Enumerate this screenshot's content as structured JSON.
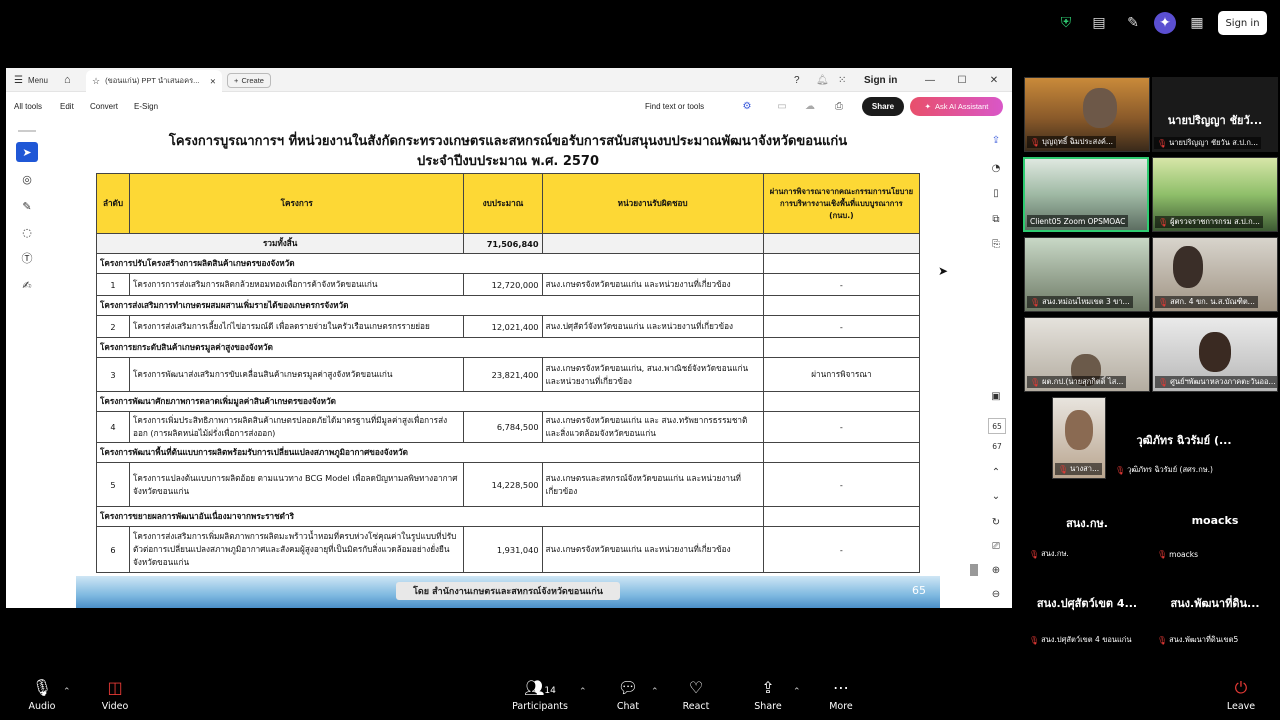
{
  "zoom_top": {
    "sign_in": "Sign in"
  },
  "acrobat": {
    "menu_label": "Menu",
    "tab_title": "(ขอนแก่น) PPT นำเสนอคร...",
    "create_label": "Create",
    "sign_in": "Sign in",
    "menu_items": [
      "All tools",
      "Edit",
      "Convert",
      "E-Sign"
    ],
    "find_text": "Find text or tools",
    "share_label": "Share",
    "ai_label": "Ask AI Assistant"
  },
  "document": {
    "title_line1": "โครงการบูรณาการฯ ที่หน่วยงานในสังกัดกระทรวงเกษตรและสหกรณ์ขอรับการสนับสนุนงบประมาณพัฒนาจังหวัดขอนแก่น",
    "title_line2": "ประจำปีงบประมาณ พ.ศ. 2570",
    "headers": {
      "no": "ลำดับ",
      "project": "โครงการ",
      "budget": "งบประมาณ",
      "agency": "หน่วยงานรับผิดชอบ",
      "review": "ผ่านการพิจารณาจากคณะกรรมการนโยบายการบริหารงานเชิงพื้นที่แบบบูรณาการ (กนบ.)"
    },
    "total_label": "รวมทั้งสิ้น",
    "total_value": "71,506,840",
    "groups": [
      {
        "title": "โครงการปรับโครงสร้างการผลิตสินค้าเกษตรของจังหวัด",
        "item": {
          "no": "1",
          "project": "โครงการการส่งเสริมการผลิตกล้วยหอมทองเพื่อการค้าจังหวัดขอนแก่น",
          "budget": "12,720,000",
          "agency": "สนง.เกษตรจังหวัดขอนแก่น และหน่วยงานที่เกี่ยวข้อง",
          "review": "-"
        }
      },
      {
        "title": "โครงการส่งเสริมการทำเกษตรผสมผสานเพิ่มรายได้ของเกษตรกรจังหวัด",
        "item": {
          "no": "2",
          "project": "โครงการส่งเสริมการเลี้ยงไก่ไข่อารมณ์ดี เพื่อลดรายจ่ายในครัวเรือนเกษตรกรรายย่อย",
          "budget": "12,021,400",
          "agency": "สนง.ปศุสัตว์จังหวัดขอนแก่น และหน่วยงานที่เกี่ยวข้อง",
          "review": "-"
        }
      },
      {
        "title": "โครงการยกระดับสินค้าเกษตรมูลค่าสูงของจังหวัด",
        "item": {
          "no": "3",
          "project": "โครงการพัฒนาส่งเสริมการขับเคลื่อนสินค้าเกษตรมูลค่าสูงจังหวัดขอนแก่น",
          "budget": "23,821,400",
          "agency": "สนง.เกษตรจังหวัดขอนแก่น, สนง.พาณิชย์จังหวัดขอนแก่น และหน่วยงานที่เกี่ยวข้อง",
          "review": "ผ่านการพิจารณา"
        }
      },
      {
        "title": "โครงการพัฒนาศักยภาพการตลาดเพิ่มมูลค่าสินค้าเกษตรของจังหวัด",
        "item": {
          "no": "4",
          "project": "โครงการเพิ่มประสิทธิภาพการผลิตสินค้าเกษตรปลอดภัยได้มาตรฐานที่มีมูลค่าสูงเพื่อการส่งออก (การผลิตหน่อไม้ฝรั่งเพื่อการส่งออก)",
          "budget": "6,784,500",
          "agency": "สนง.เกษตรจังหวัดขอนแก่น และ สนง.ทรัพยากรธรรมชาติและสิ่งแวดล้อมจังหวัดขอนแก่น",
          "review": "-"
        }
      },
      {
        "title": "โครงการพัฒนาพื้นที่ต้นแบบการผลิตพร้อมรับการเปลี่ยนแปลงสภาพภูมิอากาศของจังหวัด",
        "item": {
          "no": "5",
          "project": "โครงการแปลงต้นแบบการผลิตอ้อย ตามแนวทาง BCG Model เพื่อลดปัญหามลพิษทางอากาศ จังหวัดขอนแก่น",
          "budget": "14,228,500",
          "agency": "สนง.เกษตรและสหกรณ์จังหวัดขอนแก่น และหน่วยงานที่เกี่ยวข้อง",
          "review": "-"
        }
      },
      {
        "title": "โครงการขยายผลการพัฒนาอันเนื่องมาจากพระราชดำริ",
        "item": {
          "no": "6",
          "project": "โครงการส่งเสริมการเพิ่มผลิตภาพการผลิตมะพร้าวน้ำหอมที่ครบห่วงโซ่คุณค่าในรูปแบบที่ปรับตัวต่อการเปลี่ยนแปลงสภาพภูมิอากาศและสังคมผู้สูงอายุที่เป็นมิตรกับสิ่งแวดล้อมอย่างยั่งยืน จังหวัดขอนแก่น",
          "budget": "1,931,040",
          "agency": "สนง.เกษตรจังหวัดขอนแก่น และหน่วยงานที่เกี่ยวข้อง",
          "review": "-"
        }
      }
    ],
    "footer": "โดย สำนักงานเกษตรและสหกรณ์จังหวัดขอนแก่น",
    "slide_number": "65",
    "page_current": "65",
    "page_total": "67"
  },
  "participants": [
    {
      "label": "บุญฤทธิ์ ฉิมประสงค์...",
      "big": ""
    },
    {
      "label": "นายปริญญา ชัยวัน ส.ป.ก...",
      "big": "นายปริญญา ชัยวั..."
    },
    {
      "label": "Client05 Zoom OPSMOAC",
      "big": ""
    },
    {
      "label": "ผู้ตรวจราชการกรม ส.ป.ก...",
      "big": ""
    },
    {
      "label": "สนง.หม่อนไหมเขต 3 ขา...",
      "big": ""
    },
    {
      "label": "สศก. 4 ขก. น.ส.บัณฑิต...",
      "big": ""
    },
    {
      "label": "ผต.กป.(นายสุกกิตติ์ ไส...",
      "big": ""
    },
    {
      "label": "ศูนย์ฯพัฒนาหลวงภาคตะวันออ...",
      "big": ""
    },
    {
      "label": "นางสา...",
      "big": ""
    },
    {
      "label": "วุฒิภัทร ฉิวรัมย์ (สศร.กษ.)",
      "big": "วุฒิภัทร ฉิวรัมย์ (..."
    },
    {
      "label": "สนง.กษ.",
      "big": "สนง.กษ."
    },
    {
      "label": "moacks",
      "big": "moacks"
    },
    {
      "label": "สนง.ปศุสัตว์เขต 4 ขอนแก่น",
      "big": "สนง.ปศุสัตว์เขต 4..."
    },
    {
      "label": "สนง.พัฒนาที่ดินเขต5",
      "big": "สนง.พัฒนาที่ดิน..."
    }
  ],
  "zoom_bottom": {
    "audio": "Audio",
    "video": "Video",
    "participants": "Participants",
    "participants_count": "14",
    "chat": "Chat",
    "react": "React",
    "share": "Share",
    "more": "More",
    "leave": "Leave"
  }
}
